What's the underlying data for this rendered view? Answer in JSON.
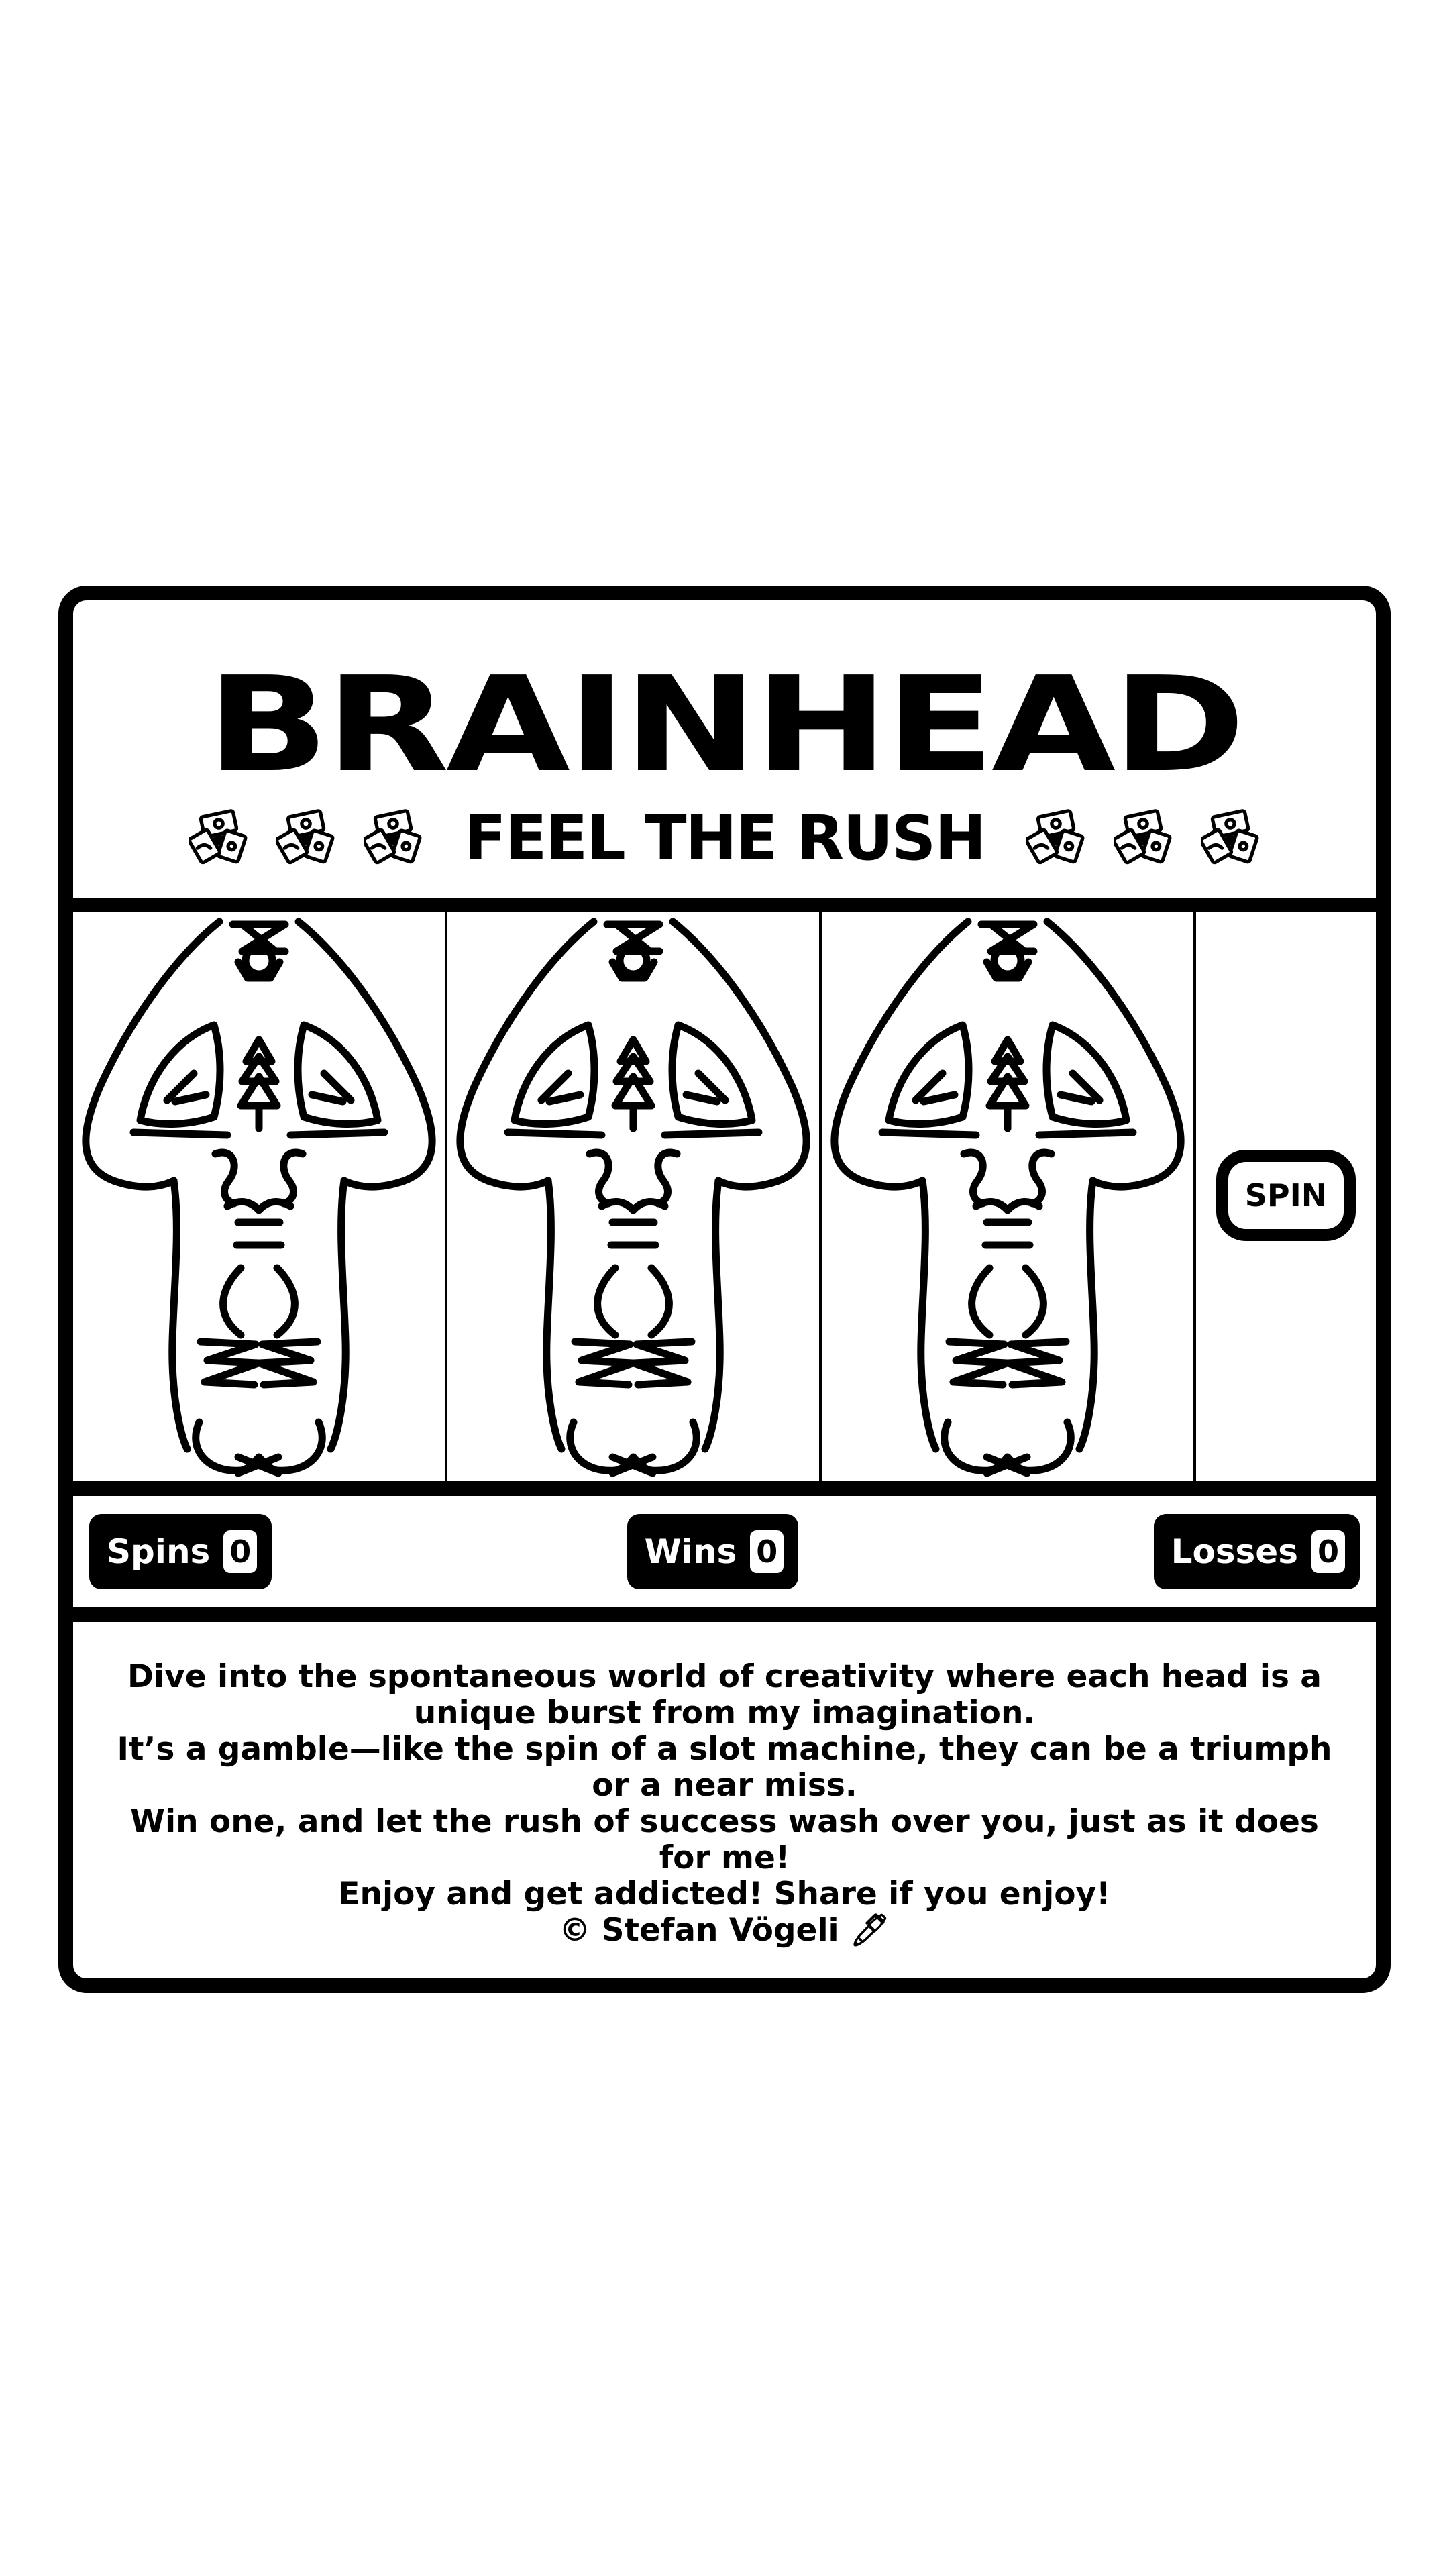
{
  "game": {
    "title": "BRAINHEAD",
    "tagline": "FEEL THE RUSH",
    "decor_icon": "money-fan-icon",
    "reels": [
      {
        "symbol": "brainhead-face"
      },
      {
        "symbol": "brainhead-face"
      },
      {
        "symbol": "brainhead-face"
      }
    ],
    "spin_label": "SPIN",
    "stats": {
      "spins_label": "Spins",
      "spins_value": "0",
      "wins_label": "Wins",
      "wins_value": "0",
      "losses_label": "Losses",
      "losses_value": "0"
    },
    "description": [
      "Dive into the spontaneous world of creativity where each head is a unique burst from my imagination.",
      "It’s a gamble—like the spin of a slot machine, they can be a triumph or a near miss.",
      "Win one, and let the rush of success wash over you, just as it does for me!",
      "Enjoy and get addicted! Share if you enjoy!",
      "© Stefan Vögeli 🖊"
    ]
  },
  "colors": {
    "ink": "#000000",
    "paper": "#ffffff"
  }
}
